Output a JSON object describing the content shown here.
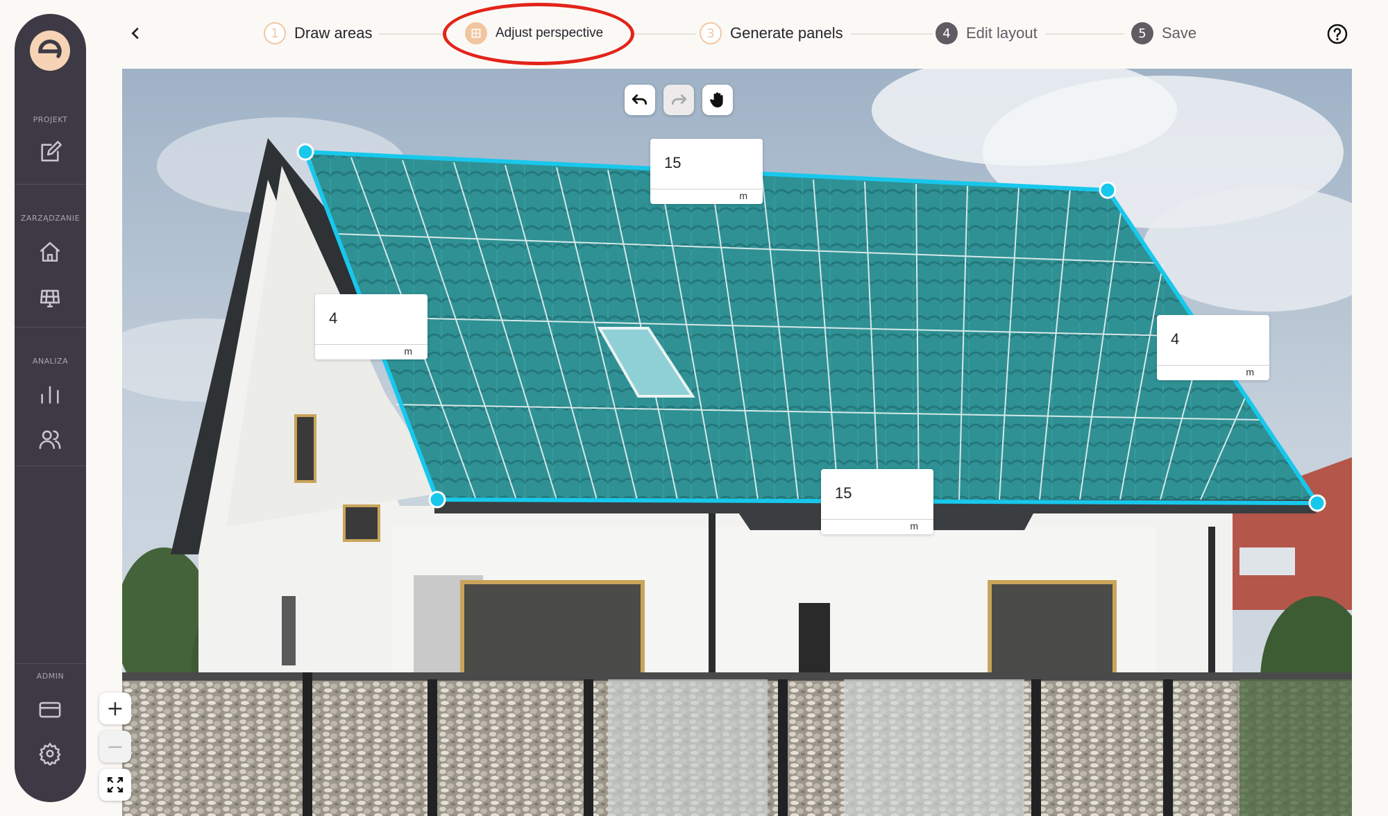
{
  "sidebar": {
    "sections": [
      {
        "label": "PROJEKT"
      },
      {
        "label": "ZARZĄDZANIE"
      },
      {
        "label": "ANALIZA"
      },
      {
        "label": "ADMIN"
      }
    ],
    "icons": [
      "edit-icon",
      "home-icon",
      "solar-grid-icon",
      "bar-chart-icon",
      "users-icon",
      "card-icon",
      "settings-icon"
    ]
  },
  "steps": [
    {
      "num": "1",
      "label": "Draw areas",
      "state": "done"
    },
    {
      "num": "",
      "label": "Adjust perspective",
      "state": "active"
    },
    {
      "num": "3",
      "label": "Generate panels",
      "state": "upcoming-outline"
    },
    {
      "num": "4",
      "label": "Edit layout",
      "state": "upcoming"
    },
    {
      "num": "5",
      "label": "Save",
      "state": "upcoming"
    }
  ],
  "dimensions": {
    "top": {
      "value": "15",
      "unit": "m"
    },
    "left": {
      "value": "4",
      "unit": "m"
    },
    "right": {
      "value": "4",
      "unit": "m"
    },
    "bottom": {
      "value": "15",
      "unit": "m"
    }
  },
  "colors": {
    "accent": "#f0c6a0",
    "sidebar": "#3d3a45",
    "outline": "#18c8ec",
    "panels": "#2e8f93",
    "highlight": "#e3241a"
  }
}
